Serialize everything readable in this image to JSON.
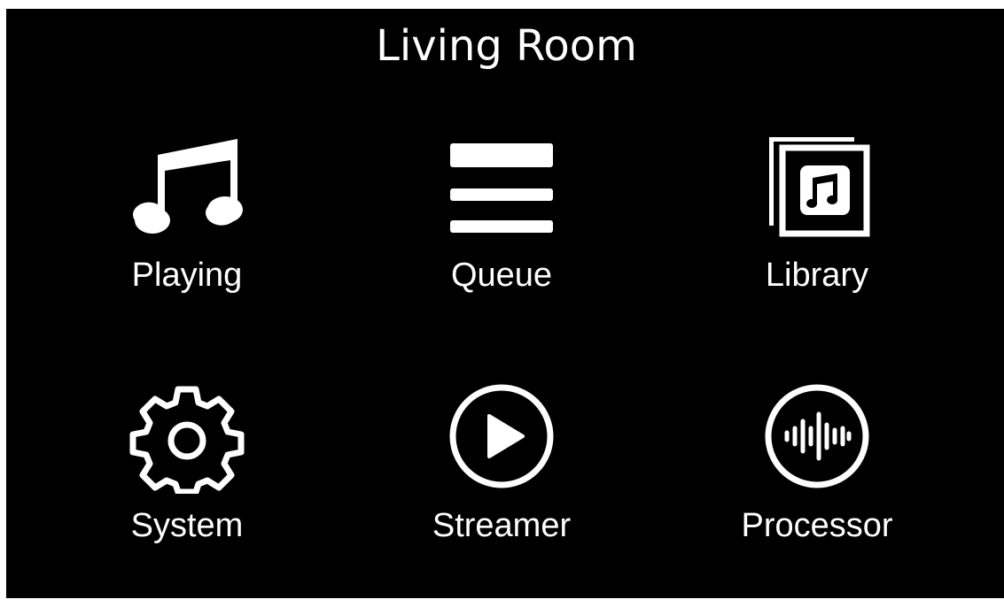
{
  "header": {
    "title": "Living Room"
  },
  "tiles": [
    {
      "label": "Playing",
      "icon": "music-note-icon"
    },
    {
      "label": "Queue",
      "icon": "queue-list-icon"
    },
    {
      "label": "Library",
      "icon": "library-album-icon"
    },
    {
      "label": "System",
      "icon": "gear-icon"
    },
    {
      "label": "Streamer",
      "icon": "play-circle-icon"
    },
    {
      "label": "Processor",
      "icon": "waveform-circle-icon"
    }
  ],
  "colors": {
    "background": "#000000",
    "foreground": "#ffffff"
  }
}
